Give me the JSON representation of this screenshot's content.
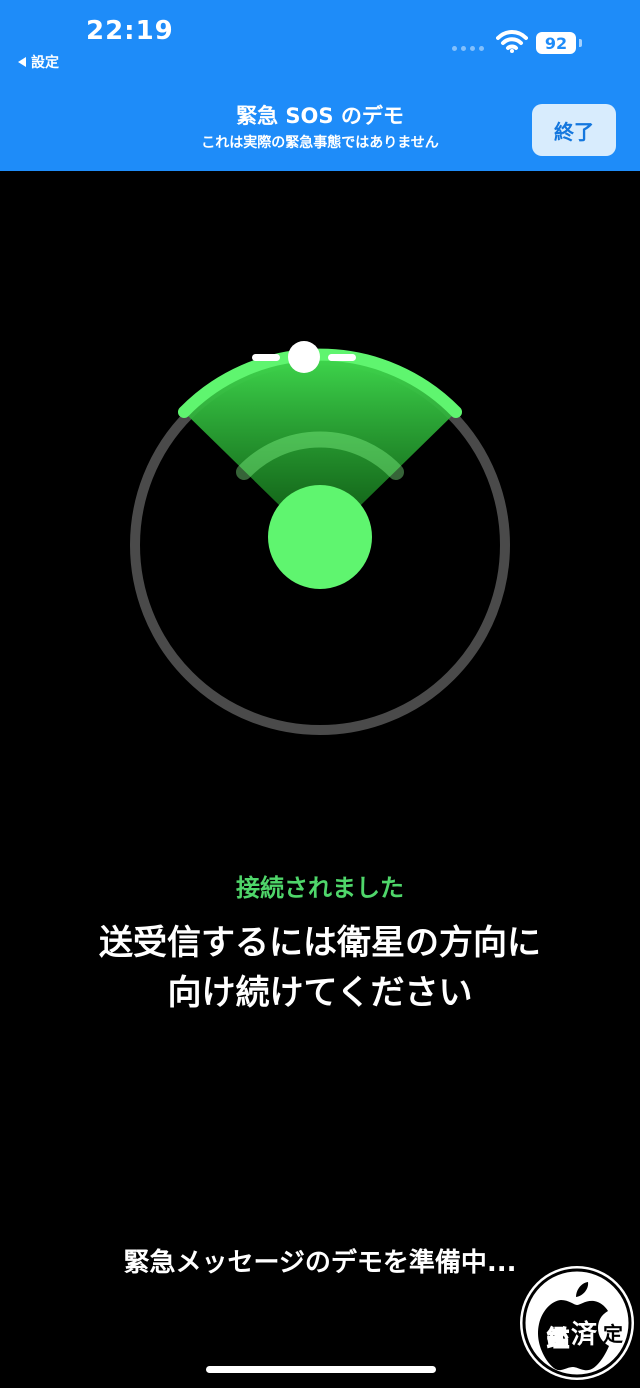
{
  "status_bar": {
    "time": "22:19",
    "back_label": "設定",
    "battery": "92",
    "icons": [
      "signal-dots-icon",
      "wifi-icon",
      "battery-icon"
    ]
  },
  "header": {
    "title": "緊急 SOS のデモ",
    "subtitle": "これは実際の緊急事態ではありません",
    "end_button": "終了"
  },
  "radar": {
    "ring_color": "#4a4a4a",
    "accent_color": "#5ff56f"
  },
  "message": {
    "connected": "接続されました",
    "instruction_line1": "送受信するには衛星の方向に",
    "instruction_line2": "向け続けてください",
    "preparing": "緊急メッセージのデモを準備中..."
  },
  "watermark": {
    "text_1": "鑑",
    "text_2": "済",
    "text_3": "定"
  },
  "colors": {
    "accent": "#1e8cf9",
    "connected": "#4fd66a",
    "background": "#000000"
  }
}
